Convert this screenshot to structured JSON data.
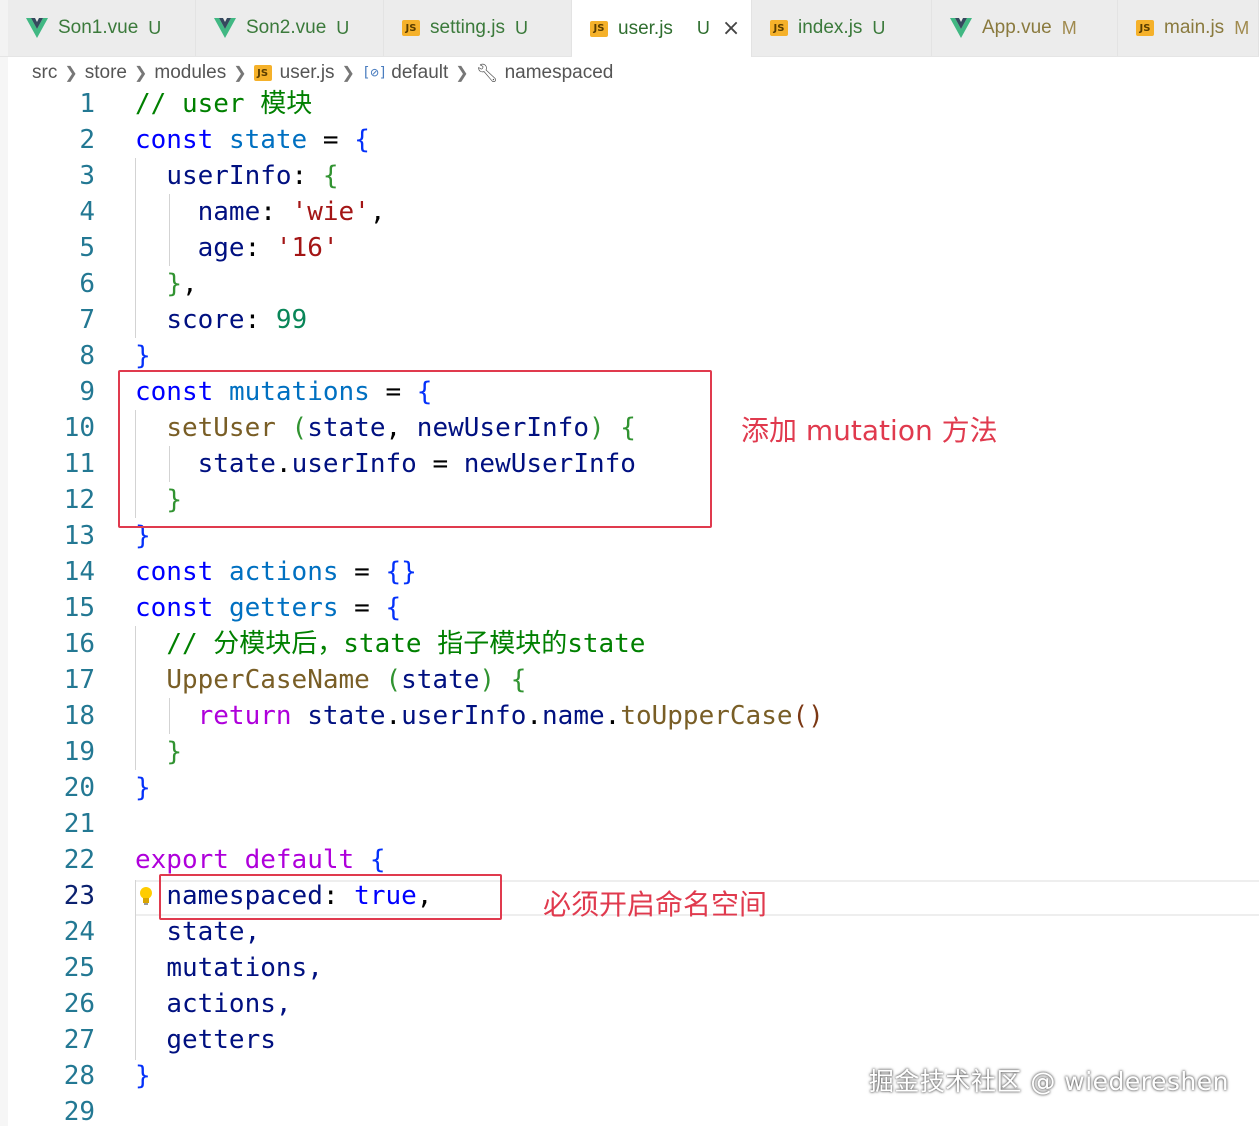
{
  "tabs": [
    {
      "name": "Son1.vue",
      "status": "U",
      "icon": "vue-icon",
      "modified": false,
      "active": false
    },
    {
      "name": "Son2.vue",
      "status": "U",
      "icon": "vue-icon",
      "modified": false,
      "active": false
    },
    {
      "name": "setting.js",
      "status": "U",
      "icon": "js-icon",
      "modified": false,
      "active": false
    },
    {
      "name": "user.js",
      "status": "U",
      "icon": "js-icon",
      "modified": false,
      "active": true
    },
    {
      "name": "index.js",
      "status": "U",
      "icon": "js-icon",
      "modified": false,
      "active": false
    },
    {
      "name": "App.vue",
      "status": "M",
      "icon": "vue-icon",
      "modified": true,
      "active": false
    },
    {
      "name": "main.js",
      "status": "M",
      "icon": "js-icon",
      "modified": true,
      "active": false
    }
  ],
  "js_icon_text": "JS",
  "close_glyph": "×",
  "breadcrumb": [
    "src",
    "store",
    "modules",
    "user.js",
    "default",
    "namespaced"
  ],
  "breadcrumb_symbol_glyph": "[⊘]",
  "line_numbers": [
    "1",
    "2",
    "3",
    "4",
    "5",
    "6",
    "7",
    "8",
    "9",
    "10",
    "11",
    "12",
    "13",
    "14",
    "15",
    "16",
    "17",
    "18",
    "19",
    "20",
    "21",
    "22",
    "23",
    "24",
    "25",
    "26",
    "27",
    "28",
    "29"
  ],
  "code": {
    "l1": "// user 模块",
    "l2_kw": "const",
    "l2_var": "state",
    "l2_eq": "=",
    "l2_br": "{",
    "l3_prop": "userInfo",
    "l3_colon": ":",
    "l3_br": "{",
    "l4_prop": "name",
    "l4_colon": ":",
    "l4_str": "'wie'",
    "l4_comma": ",",
    "l5_prop": "age",
    "l5_colon": ":",
    "l5_str": "'16'",
    "l6_br": "}",
    "l6_comma": ",",
    "l7_prop": "score",
    "l7_colon": ":",
    "l7_num": "99",
    "l8_br": "}",
    "l9_kw": "const",
    "l9_var": "mutations",
    "l9_eq": "=",
    "l9_br": "{",
    "l10_fn": "setUser",
    "l10_p1": "(",
    "l10_a": "state",
    "l10_c": ",",
    "l10_b": "newUserInfo",
    "l10_p2": ")",
    "l10_br": "{",
    "l11_a": "state",
    "l11_dot": ".",
    "l11_b": "userInfo",
    "l11_eq": "=",
    "l11_c": "newUserInfo",
    "l12_br": "}",
    "l13_br": "}",
    "l14_kw": "const",
    "l14_var": "actions",
    "l14_eq": "=",
    "l14_br": "{}",
    "l15_kw": "const",
    "l15_var": "getters",
    "l15_eq": "=",
    "l15_br": "{",
    "l16": "// 分模块后，state 指子模块的state",
    "l17_fn": "UpperCaseName",
    "l17_p1": "(",
    "l17_a": "state",
    "l17_p2": ")",
    "l17_br": "{",
    "l18_kw": "return",
    "l18_a": "state",
    "l18_d1": ".",
    "l18_b": "userInfo",
    "l18_d2": ".",
    "l18_c": "name",
    "l18_d3": ".",
    "l18_fn": "toUpperCase",
    "l18_p": "()",
    "l19_br": "}",
    "l20_br": "}",
    "l22_kw1": "export",
    "l22_kw2": "default",
    "l22_br": "{",
    "l23_prop": "namespaced",
    "l23_colon": ":",
    "l23_val": "true",
    "l23_comma": ",",
    "l24": "state,",
    "l25": "mutations,",
    "l26": "actions,",
    "l27": "getters",
    "l28_br": "}"
  },
  "annotations": {
    "mutation_note": "添加 mutation 方法",
    "namespace_note": "必须开启命名空间"
  },
  "watermark": "掘金技术社区 @ wiedereshen",
  "colors": {
    "annotation_red": "#e03a4e",
    "keyword_blue": "#0000ff",
    "string_red": "#a31515",
    "number_green": "#098658",
    "comment_green": "#008000"
  }
}
